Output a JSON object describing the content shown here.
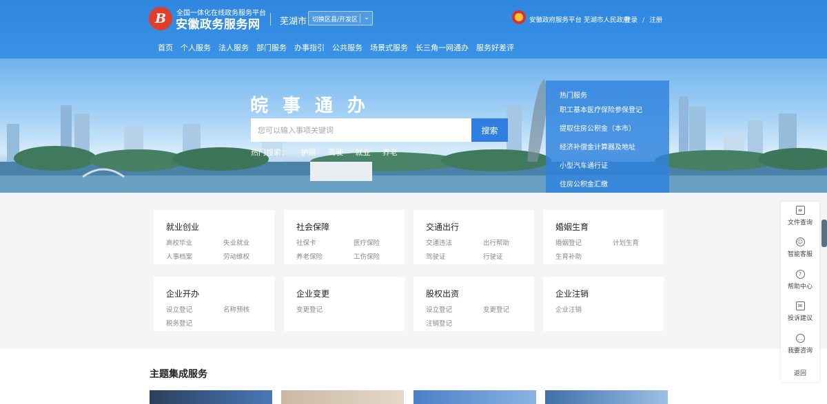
{
  "header": {
    "logo_mark": "B",
    "logo_subtitle": "全国一体化在线政务服务平台",
    "logo_title": "安徽政务服务网",
    "city": "芜湖市",
    "city_select": "切换区县/开发区",
    "gov_text": "安徽政府服务平台  芜湖市人民政府",
    "login": "登录",
    "register": "注册"
  },
  "nav": [
    "首页",
    "个人服务",
    "法人服务",
    "部门服务",
    "办事指引",
    "公共服务",
    "场景式服务",
    "长三角一网通办",
    "服务好差评"
  ],
  "banner": {
    "slogan": "皖事通办",
    "search_placeholder": "您可以输入事项关键词",
    "search_button": "搜索",
    "hot_label": "热门搜索：",
    "hot_words": [
      "护照",
      "驾驶",
      "就业",
      "养老"
    ]
  },
  "hot_panel": {
    "title": "热门服务",
    "items": [
      "职工基本医疗保险参保登记",
      "提取住房公积金（本市）",
      "经济补偿金计算器及地址",
      "小型汽车通行证",
      "住房公积金汇缴"
    ]
  },
  "cards": [
    {
      "title": "就业创业",
      "links": [
        "高校毕业",
        "失业就业",
        "人事档案",
        "劳动维权"
      ]
    },
    {
      "title": "社会保障",
      "links": [
        "社保卡",
        "医疗保险",
        "养老保险",
        "工伤保险"
      ]
    },
    {
      "title": "交通出行",
      "links": [
        "交通违法",
        "出行帮助",
        "驾驶证",
        "行驶证"
      ]
    },
    {
      "title": "婚姻生育",
      "links": [
        "婚姻登记",
        "计划生育",
        "生育补助"
      ]
    },
    {
      "title": "企业开办",
      "links": [
        "设立登记",
        "名称预核",
        "税务登记"
      ]
    },
    {
      "title": "企业变更",
      "links": [
        "变更登记"
      ]
    },
    {
      "title": "股权出资",
      "links": [
        "设立登记",
        "变更登记",
        "注销登记"
      ]
    },
    {
      "title": "企业注销",
      "links": [
        "企业注销"
      ]
    }
  ],
  "theme": {
    "title": "主题集成服务"
  },
  "sidebar": [
    {
      "label": "文件查询",
      "icon": "document-icon"
    },
    {
      "label": "智能客服",
      "icon": "robot-icon"
    },
    {
      "label": "帮助中心",
      "icon": "question-icon"
    },
    {
      "label": "投诉建议",
      "icon": "mail-icon"
    },
    {
      "label": "我要咨询",
      "icon": "chat-icon"
    },
    {
      "label": "返回",
      "icon": "top-icon"
    }
  ]
}
